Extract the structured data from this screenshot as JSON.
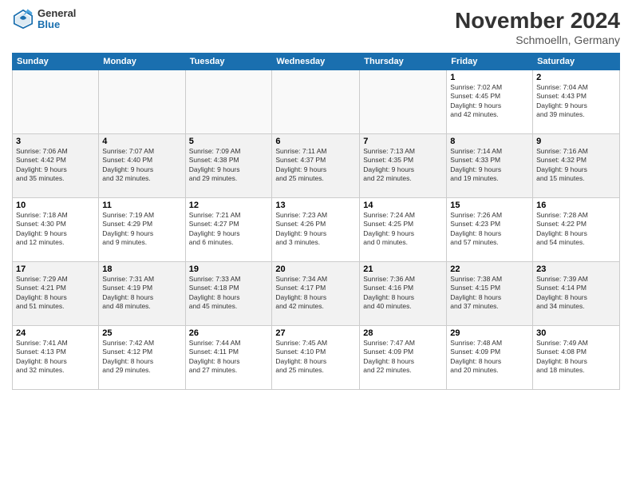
{
  "header": {
    "logo_general": "General",
    "logo_blue": "Blue",
    "month_title": "November 2024",
    "location": "Schmoelln, Germany"
  },
  "days_of_week": [
    "Sunday",
    "Monday",
    "Tuesday",
    "Wednesday",
    "Thursday",
    "Friday",
    "Saturday"
  ],
  "weeks": [
    [
      {
        "day": "",
        "info": ""
      },
      {
        "day": "",
        "info": ""
      },
      {
        "day": "",
        "info": ""
      },
      {
        "day": "",
        "info": ""
      },
      {
        "day": "",
        "info": ""
      },
      {
        "day": "1",
        "info": "Sunrise: 7:02 AM\nSunset: 4:45 PM\nDaylight: 9 hours\nand 42 minutes."
      },
      {
        "day": "2",
        "info": "Sunrise: 7:04 AM\nSunset: 4:43 PM\nDaylight: 9 hours\nand 39 minutes."
      }
    ],
    [
      {
        "day": "3",
        "info": "Sunrise: 7:06 AM\nSunset: 4:42 PM\nDaylight: 9 hours\nand 35 minutes."
      },
      {
        "day": "4",
        "info": "Sunrise: 7:07 AM\nSunset: 4:40 PM\nDaylight: 9 hours\nand 32 minutes."
      },
      {
        "day": "5",
        "info": "Sunrise: 7:09 AM\nSunset: 4:38 PM\nDaylight: 9 hours\nand 29 minutes."
      },
      {
        "day": "6",
        "info": "Sunrise: 7:11 AM\nSunset: 4:37 PM\nDaylight: 9 hours\nand 25 minutes."
      },
      {
        "day": "7",
        "info": "Sunrise: 7:13 AM\nSunset: 4:35 PM\nDaylight: 9 hours\nand 22 minutes."
      },
      {
        "day": "8",
        "info": "Sunrise: 7:14 AM\nSunset: 4:33 PM\nDaylight: 9 hours\nand 19 minutes."
      },
      {
        "day": "9",
        "info": "Sunrise: 7:16 AM\nSunset: 4:32 PM\nDaylight: 9 hours\nand 15 minutes."
      }
    ],
    [
      {
        "day": "10",
        "info": "Sunrise: 7:18 AM\nSunset: 4:30 PM\nDaylight: 9 hours\nand 12 minutes."
      },
      {
        "day": "11",
        "info": "Sunrise: 7:19 AM\nSunset: 4:29 PM\nDaylight: 9 hours\nand 9 minutes."
      },
      {
        "day": "12",
        "info": "Sunrise: 7:21 AM\nSunset: 4:27 PM\nDaylight: 9 hours\nand 6 minutes."
      },
      {
        "day": "13",
        "info": "Sunrise: 7:23 AM\nSunset: 4:26 PM\nDaylight: 9 hours\nand 3 minutes."
      },
      {
        "day": "14",
        "info": "Sunrise: 7:24 AM\nSunset: 4:25 PM\nDaylight: 9 hours\nand 0 minutes."
      },
      {
        "day": "15",
        "info": "Sunrise: 7:26 AM\nSunset: 4:23 PM\nDaylight: 8 hours\nand 57 minutes."
      },
      {
        "day": "16",
        "info": "Sunrise: 7:28 AM\nSunset: 4:22 PM\nDaylight: 8 hours\nand 54 minutes."
      }
    ],
    [
      {
        "day": "17",
        "info": "Sunrise: 7:29 AM\nSunset: 4:21 PM\nDaylight: 8 hours\nand 51 minutes."
      },
      {
        "day": "18",
        "info": "Sunrise: 7:31 AM\nSunset: 4:19 PM\nDaylight: 8 hours\nand 48 minutes."
      },
      {
        "day": "19",
        "info": "Sunrise: 7:33 AM\nSunset: 4:18 PM\nDaylight: 8 hours\nand 45 minutes."
      },
      {
        "day": "20",
        "info": "Sunrise: 7:34 AM\nSunset: 4:17 PM\nDaylight: 8 hours\nand 42 minutes."
      },
      {
        "day": "21",
        "info": "Sunrise: 7:36 AM\nSunset: 4:16 PM\nDaylight: 8 hours\nand 40 minutes."
      },
      {
        "day": "22",
        "info": "Sunrise: 7:38 AM\nSunset: 4:15 PM\nDaylight: 8 hours\nand 37 minutes."
      },
      {
        "day": "23",
        "info": "Sunrise: 7:39 AM\nSunset: 4:14 PM\nDaylight: 8 hours\nand 34 minutes."
      }
    ],
    [
      {
        "day": "24",
        "info": "Sunrise: 7:41 AM\nSunset: 4:13 PM\nDaylight: 8 hours\nand 32 minutes."
      },
      {
        "day": "25",
        "info": "Sunrise: 7:42 AM\nSunset: 4:12 PM\nDaylight: 8 hours\nand 29 minutes."
      },
      {
        "day": "26",
        "info": "Sunrise: 7:44 AM\nSunset: 4:11 PM\nDaylight: 8 hours\nand 27 minutes."
      },
      {
        "day": "27",
        "info": "Sunrise: 7:45 AM\nSunset: 4:10 PM\nDaylight: 8 hours\nand 25 minutes."
      },
      {
        "day": "28",
        "info": "Sunrise: 7:47 AM\nSunset: 4:09 PM\nDaylight: 8 hours\nand 22 minutes."
      },
      {
        "day": "29",
        "info": "Sunrise: 7:48 AM\nSunset: 4:09 PM\nDaylight: 8 hours\nand 20 minutes."
      },
      {
        "day": "30",
        "info": "Sunrise: 7:49 AM\nSunset: 4:08 PM\nDaylight: 8 hours\nand 18 minutes."
      }
    ]
  ]
}
